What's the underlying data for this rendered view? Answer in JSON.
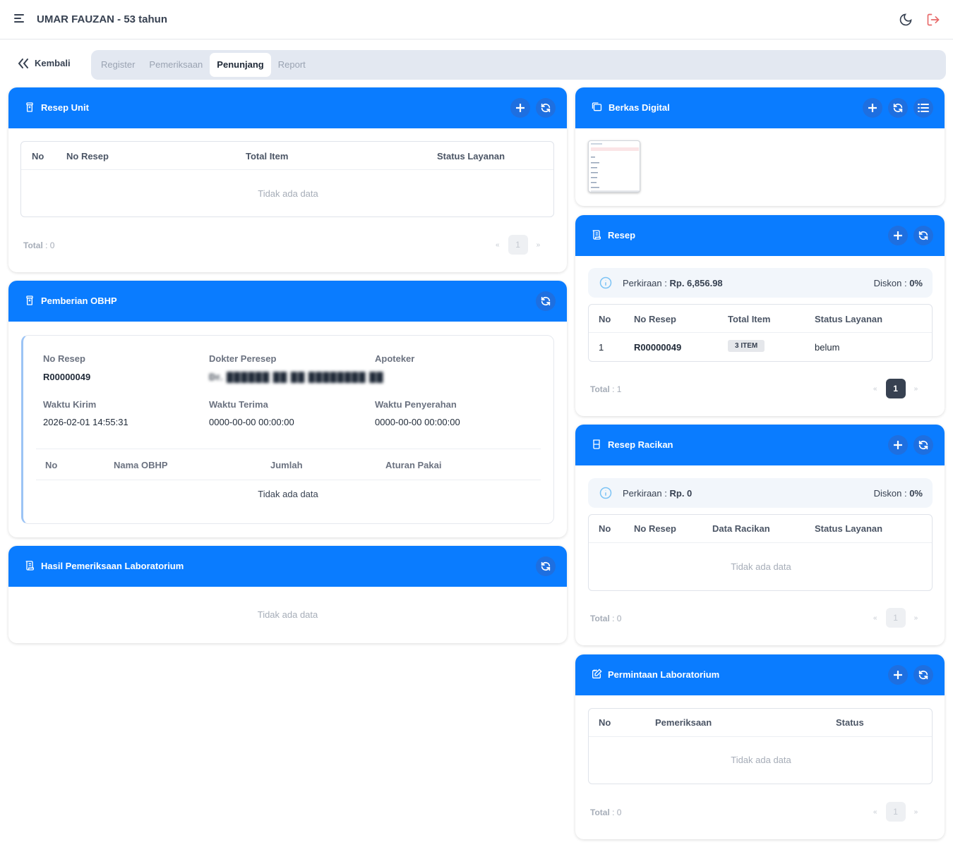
{
  "header": {
    "title": "UMAR FAUZAN - 53 tahun"
  },
  "nav": {
    "back_label": "Kembali",
    "tabs": [
      "Register",
      "Pemeriksaan",
      "Penunjang",
      "Report"
    ],
    "active_tab": "Penunjang"
  },
  "resep_unit": {
    "title": "Resep Unit",
    "columns": [
      "No",
      "No Resep",
      "Total Item",
      "Status Layanan"
    ],
    "empty": "Tidak ada data",
    "total_label": "Total",
    "total_value": ": 0",
    "page": "1"
  },
  "obhp": {
    "title": "Pemberian OBHP",
    "no_resep_label": "No Resep",
    "no_resep": "R00000049",
    "dokter_label": "Dokter Peresep",
    "dokter": "Dr. ██████ ██ ██ ████████ ██",
    "apoteker_label": "Apoteker",
    "waktu_kirim_label": "Waktu Kirim",
    "waktu_kirim": "2026-02-01 14:55:31",
    "waktu_terima_label": "Waktu Terima",
    "waktu_terima": "0000-00-00 00:00:00",
    "waktu_penyerahan_label": "Waktu Penyerahan",
    "waktu_penyerahan": "0000-00-00 00:00:00",
    "columns": [
      "No",
      "Nama OBHP",
      "Jumlah",
      "Aturan Pakai"
    ],
    "empty": "Tidak ada data"
  },
  "lab_result": {
    "title": "Hasil Pemeriksaan Laboratorium",
    "empty": "Tidak ada data"
  },
  "berkas": {
    "title": "Berkas Digital"
  },
  "resep": {
    "title": "Resep",
    "perkiraan_label": "Perkiraan :",
    "perkiraan_value": "Rp. 6,856.98",
    "diskon_label": "Diskon :",
    "diskon_value": "0%",
    "columns": [
      "No",
      "No Resep",
      "Total Item",
      "Status Layanan"
    ],
    "rows": [
      {
        "no": "1",
        "no_resep": "R00000049",
        "total_item": "3 ITEM",
        "status": "belum"
      }
    ],
    "total_label": "Total",
    "total_value": ": 1",
    "page": "1"
  },
  "racikan": {
    "title": "Resep Racikan",
    "perkiraan_label": "Perkiraan :",
    "perkiraan_value": "Rp. 0",
    "diskon_label": "Diskon :",
    "diskon_value": "0%",
    "columns": [
      "No",
      "No Resep",
      "Data Racikan",
      "Status Layanan"
    ],
    "empty": "Tidak ada data",
    "total_label": "Total",
    "total_value": ": 0",
    "page": "1"
  },
  "lab_request": {
    "title": "Permintaan Laboratorium",
    "columns": [
      "No",
      "Pemeriksaan",
      "Status"
    ],
    "empty": "Tidak ada data",
    "total_label": "Total",
    "total_value": ": 0",
    "page": "1"
  },
  "colors": {
    "primary": "#0a7cff",
    "tab_bg": "#e3e8f1"
  }
}
